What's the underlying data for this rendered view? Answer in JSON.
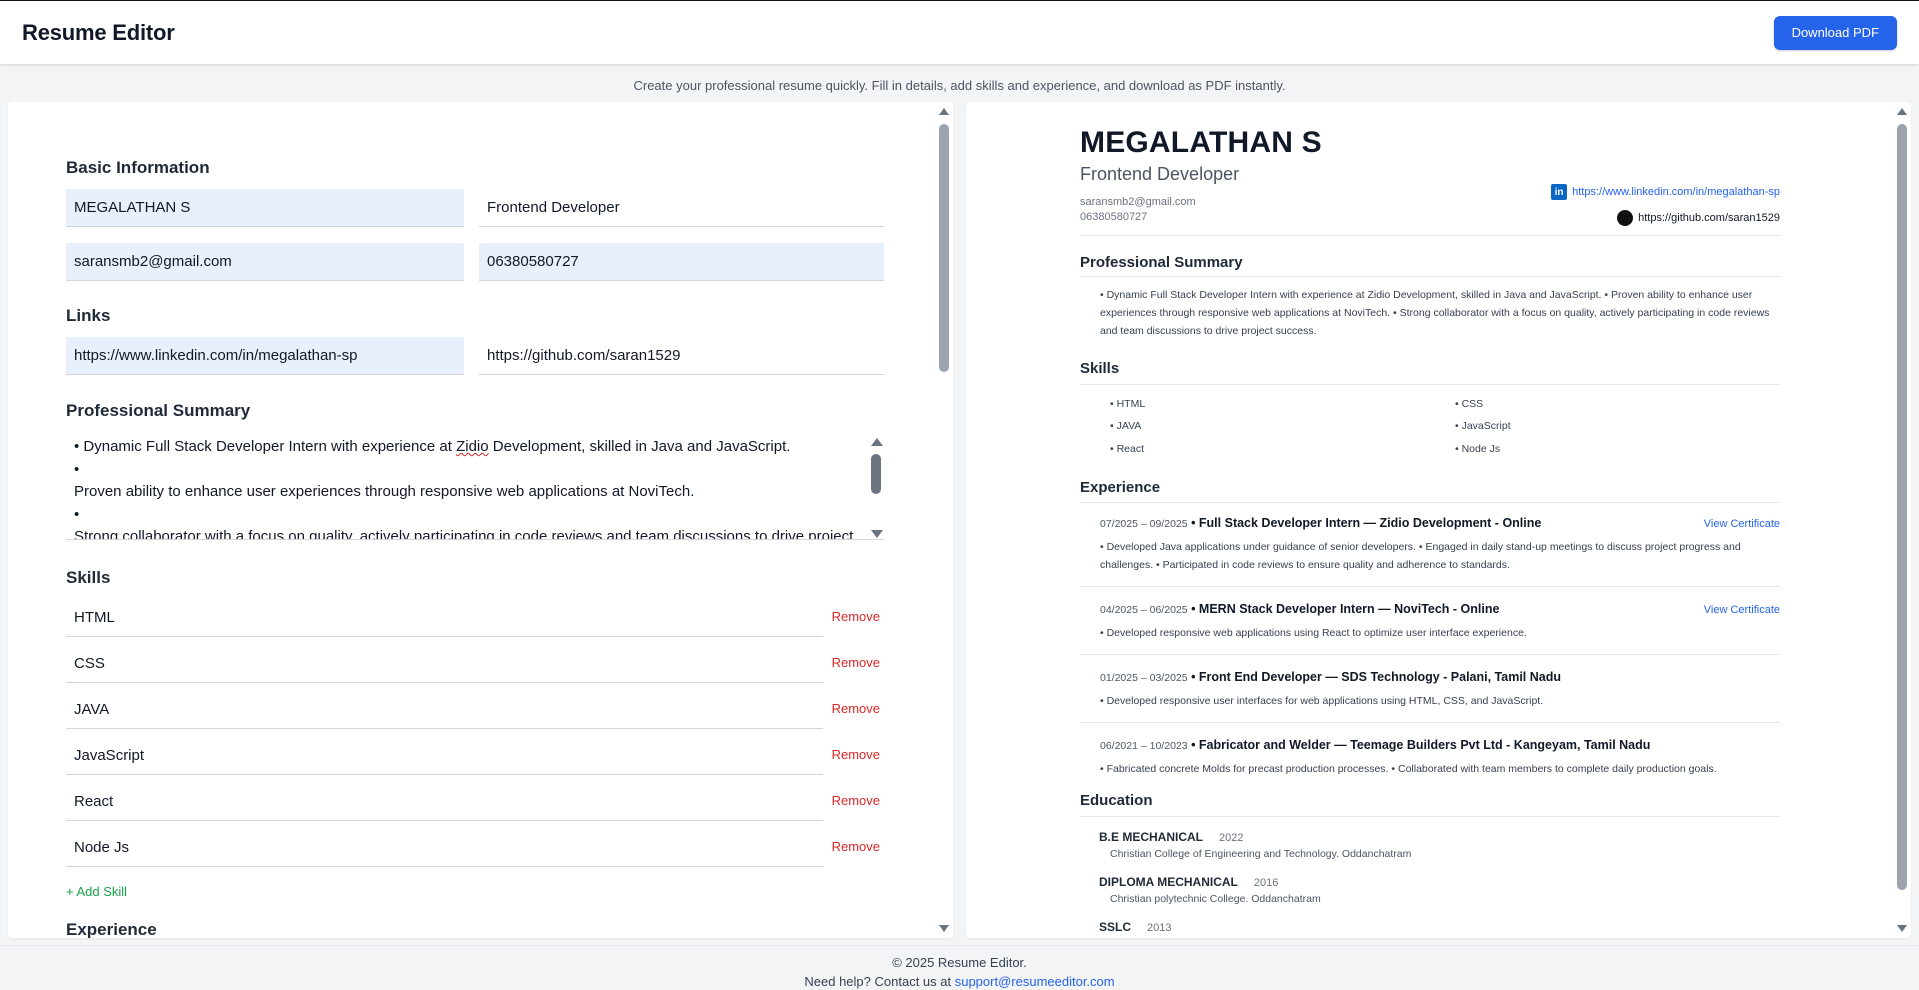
{
  "app": {
    "title": "Resume Editor",
    "download_label": "Download PDF"
  },
  "subtitle": "Create your professional resume quickly. Fill in details, add skills and experience, and download as PDF instantly.",
  "form": {
    "basic_heading": "Basic Information",
    "name": "MEGALATHAN S",
    "title": "Frontend Developer",
    "email": "saransmb2@gmail.com",
    "phone": "06380580727",
    "links_heading": "Links",
    "linkedin": "https://www.linkedin.com/in/megalathan-sp",
    "github": "https://github.com/saran1529",
    "summary_heading": "Professional Summary",
    "summary_lines": {
      "l1_pre": "• Dynamic Full Stack Developer Intern with experience at ",
      "l1_word": "Zidio",
      "l1_post": " Development, skilled in Java and JavaScript.",
      "l2": "•",
      "l3": "Proven ability to enhance user experiences through responsive web applications at NoviTech.",
      "l4": "•",
      "l5": "Strong collaborator with a focus on quality, actively participating in code reviews and team discussions to drive project success."
    },
    "skills_heading": "Skills",
    "skills": [
      "HTML",
      "CSS",
      "JAVA",
      "JavaScript",
      "React",
      "Node Js"
    ],
    "remove_label": "Remove",
    "add_skill_label": "+ Add Skill",
    "experience_heading": "Experience"
  },
  "preview": {
    "name": "MEGALATHAN S",
    "title": "Frontend Developer",
    "email": "saransmb2@gmail.com",
    "phone": "06380580727",
    "linkedin": "https://www.linkedin.com/in/megalathan-sp",
    "github": "https://github.com/saran1529",
    "summary_heading": "Professional Summary",
    "summary": "• Dynamic Full Stack Developer Intern with experience at Zidio Development, skilled in Java and JavaScript. • Proven ability to enhance user experiences through responsive web applications at NoviTech. • Strong collaborator with a focus on quality, actively participating in code reviews and team discussions to drive project success.",
    "skills_heading": "Skills",
    "skills_col1": [
      "HTML",
      "JAVA",
      "React"
    ],
    "skills_col2": [
      "CSS",
      "JavaScript",
      "Node Js"
    ],
    "experience_heading": "Experience",
    "experience": [
      {
        "dates": "07/2025 – 09/2025",
        "head": " • Full Stack Developer Intern — Zidio Development - Online",
        "cert": "View Certificate",
        "desc": "• Developed Java applications under guidance of senior developers. • Engaged in daily stand-up meetings to discuss project progress and challenges. • Participated in code reviews to ensure quality and adherence to standards."
      },
      {
        "dates": "04/2025 – 06/2025",
        "head": " • MERN Stack Developer Intern — NoviTech - Online",
        "cert": "View Certificate",
        "desc": "• Developed responsive web applications using React to optimize user interface experience."
      },
      {
        "dates": "01/2025 – 03/2025",
        "head": " • Front End Developer — SDS Technology - Palani, Tamil Nadu",
        "cert": "",
        "desc": "• Developed responsive user interfaces for web applications using HTML, CSS, and JavaScript."
      },
      {
        "dates": "06/2021 – 10/2023",
        "head": " • Fabricator and Welder — Teemage Builders Pvt Ltd - Kangeyam, Tamil Nadu",
        "cert": "",
        "desc": "• Fabricated concrete Molds for precast production processes. • Collaborated with team members to complete daily production goals."
      }
    ],
    "education_heading": "Education",
    "education": [
      {
        "degree": "B.E MECHANICAL",
        "year": "2022",
        "school": "Christian College of Engineering and Technology. Oddanchatram"
      },
      {
        "degree": "DIPLOMA MECHANICAL",
        "year": "2016",
        "school": "Christian polytechnic College. Oddanchatram"
      },
      {
        "degree": "SSLC",
        "year": "2013",
        "school": ""
      }
    ]
  },
  "footer": {
    "copyright": "© 2025 Resume Editor.",
    "help_prefix": "Need help? Contact us at ",
    "email": "support@resumeeditor.com"
  }
}
